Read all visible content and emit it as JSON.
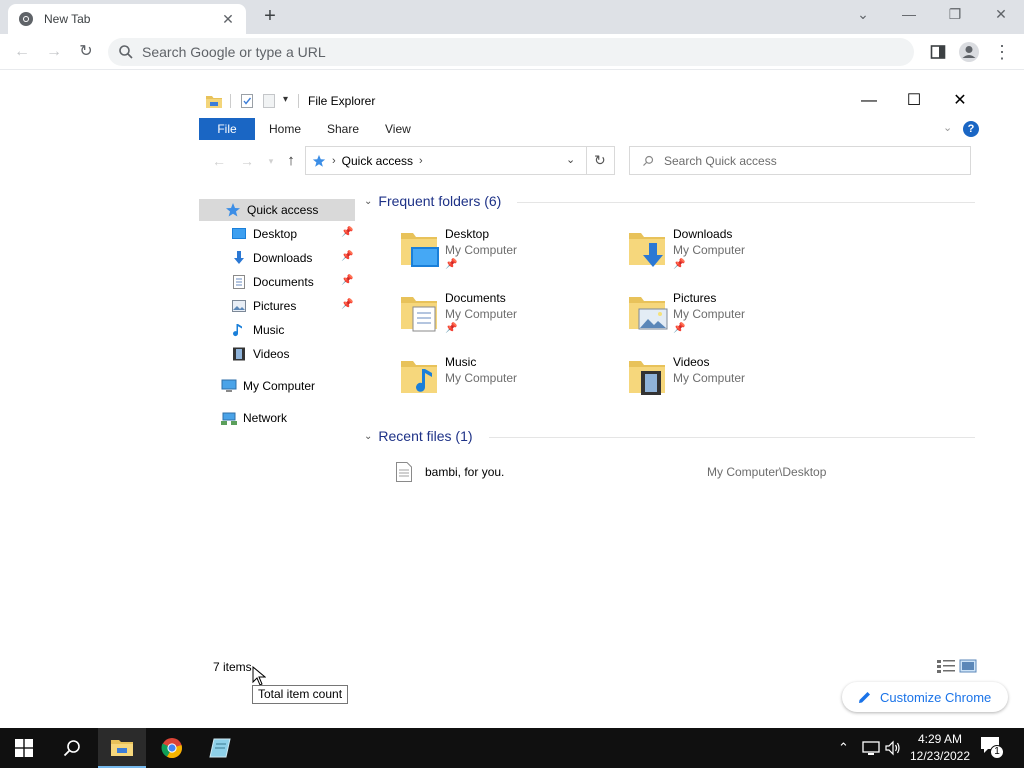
{
  "browser": {
    "tab_title": "New Tab",
    "omnibox_placeholder": "Search Google or type a URL",
    "customize_label": "Customize Chrome"
  },
  "explorer": {
    "window_title": "File Explorer",
    "ribbon": {
      "file": "File",
      "home": "Home",
      "share": "Share",
      "view": "View",
      "help": "?"
    },
    "address_crumb": "Quick access",
    "search_placeholder": "Search Quick access",
    "nav": {
      "quick_access": "Quick access",
      "desktop": "Desktop",
      "downloads": "Downloads",
      "documents": "Documents",
      "pictures": "Pictures",
      "music": "Music",
      "videos": "Videos",
      "my_computer": "My Computer",
      "network": "Network"
    },
    "frequent_header": "Frequent folders (6)",
    "frequent": [
      {
        "name": "Desktop",
        "location": "My Computer"
      },
      {
        "name": "Downloads",
        "location": "My Computer"
      },
      {
        "name": "Documents",
        "location": "My Computer"
      },
      {
        "name": "Pictures",
        "location": "My Computer"
      },
      {
        "name": "Music",
        "location": "My Computer"
      },
      {
        "name": "Videos",
        "location": "My Computer"
      }
    ],
    "recent_header": "Recent files (1)",
    "recent": [
      {
        "name": "bambi, for you.",
        "path": "My Computer\\Desktop"
      }
    ],
    "status": "7 items",
    "tooltip": "Total item count"
  },
  "taskbar": {
    "time": "4:29 AM",
    "date": "12/23/2022",
    "notification_count": "1"
  },
  "colors": {
    "accent": "#1a66c4",
    "folder": "#e8c25a",
    "taskbar": "#101010"
  }
}
